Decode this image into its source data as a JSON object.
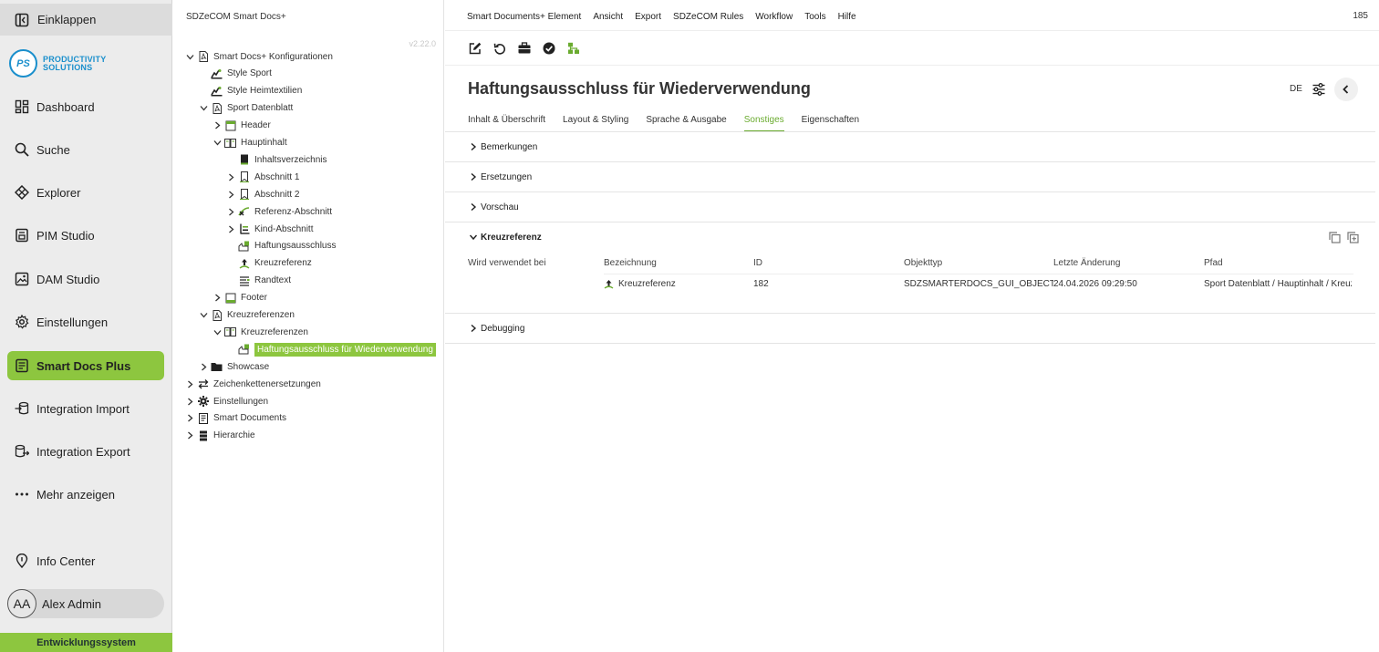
{
  "sidebar": {
    "collapse_label": "Einklappen",
    "logo_badge": "PS",
    "logo_line1": "PRODUCTIVITY",
    "logo_line2": "SOLUTIONS",
    "items": [
      {
        "label": "Dashboard",
        "icon": "dashboard-icon"
      },
      {
        "label": "Suche",
        "icon": "search-icon"
      },
      {
        "label": "Explorer",
        "icon": "explorer-icon"
      },
      {
        "label": "PIM Studio",
        "icon": "pim-icon"
      },
      {
        "label": "DAM Studio",
        "icon": "image-icon"
      },
      {
        "label": "Einstellungen",
        "icon": "gear-icon"
      },
      {
        "label": "Smart Docs Plus",
        "icon": "document-icon",
        "active": true
      },
      {
        "label": "Integration Import",
        "icon": "import-icon"
      },
      {
        "label": "Integration Export",
        "icon": "export-icon"
      },
      {
        "label": "Mehr anzeigen",
        "icon": "more-icon"
      }
    ],
    "info_center": "Info Center",
    "user_initials": "AA",
    "user_name": "Alex Admin",
    "environment": "Entwicklungssystem"
  },
  "tree": {
    "title": "SDZeCOM Smart Docs+",
    "version": "v2.22.0",
    "nodes": [
      {
        "label": "Smart Docs+ Konfigurationen",
        "icon": "pdf-icon",
        "caret": "down"
      },
      {
        "label": "Style Sport",
        "icon": "style-icon",
        "caret": "none"
      },
      {
        "label": "Style Heimtextilien",
        "icon": "style-icon",
        "caret": "none"
      },
      {
        "label": "Sport Datenblatt",
        "icon": "pdf-icon",
        "caret": "down"
      },
      {
        "label": "Header",
        "icon": "header-icon",
        "caret": "right"
      },
      {
        "label": "Hauptinhalt",
        "icon": "book-icon",
        "caret": "down"
      },
      {
        "label": "Inhaltsverzeichnis",
        "icon": "toc-icon",
        "caret": "none"
      },
      {
        "label": "Abschnitt 1",
        "icon": "bookmark-icon",
        "caret": "right"
      },
      {
        "label": "Abschnitt 2",
        "icon": "bookmark-icon",
        "caret": "right"
      },
      {
        "label": "Referenz-Abschnitt",
        "icon": "reference-icon",
        "caret": "right"
      },
      {
        "label": "Kind-Abschnitt",
        "icon": "child-section-icon",
        "caret": "right"
      },
      {
        "label": "Haftungsausschluss",
        "icon": "disclaimer-icon",
        "caret": "none"
      },
      {
        "label": "Kreuzreferenz",
        "icon": "crossref-icon",
        "caret": "none"
      },
      {
        "label": "Randtext",
        "icon": "margin-text-icon",
        "caret": "none"
      },
      {
        "label": "Footer",
        "icon": "footer-icon",
        "caret": "right"
      },
      {
        "label": "Kreuzreferenzen",
        "icon": "pdf-icon",
        "caret": "down"
      },
      {
        "label": "Kreuzreferenzen",
        "icon": "book-icon",
        "caret": "down"
      },
      {
        "label": "Haftungsausschluss für Wiederverwendung",
        "icon": "disclaimer-icon",
        "caret": "none",
        "selected": true
      },
      {
        "label": "Showcase",
        "icon": "folder-icon",
        "caret": "right"
      },
      {
        "label": "Zeichenkettenersetzungen",
        "icon": "swap-icon",
        "caret": "right"
      },
      {
        "label": "Einstellungen",
        "icon": "gear-icon",
        "caret": "right"
      },
      {
        "label": "Smart Documents",
        "icon": "docs-icon",
        "caret": "right"
      },
      {
        "label": "Hierarchie",
        "icon": "hierarchy-icon",
        "caret": "right"
      }
    ]
  },
  "menubar": {
    "items": [
      "Smart Documents+ Element",
      "Ansicht",
      "Export",
      "SDZeCOM Rules",
      "Workflow",
      "Tools",
      "Hilfe"
    ],
    "counter": "185"
  },
  "toolbar": [
    "edit-icon",
    "reload-icon",
    "briefcase-icon",
    "check-circle-icon",
    "tree-structure-icon"
  ],
  "page": {
    "title": "Haftungsausschluss für Wiederverwendung",
    "language": "DE",
    "tabs": [
      {
        "label": "Inhalt & Überschrift"
      },
      {
        "label": "Layout & Styling"
      },
      {
        "label": "Sprache & Ausgabe"
      },
      {
        "label": "Sonstiges",
        "active": true
      },
      {
        "label": "Eigenschaften"
      }
    ]
  },
  "sections": {
    "bemerkungen": "Bemerkungen",
    "ersetzungen": "Ersetzungen",
    "vorschau": "Vorschau",
    "kreuzreferenz": "Kreuzreferenz",
    "debugging": "Debugging"
  },
  "kreuzreferenz": {
    "used_in_label": "Wird verwendet bei",
    "columns": [
      "Bezeichnung",
      "ID",
      "Objekttyp",
      "Letzte Änderung",
      "Pfad"
    ],
    "rows": [
      {
        "name": "Kreuzreferenz",
        "id": "182",
        "type": "SDZSMARTERDOCS_GUI_OBJECTTYPE",
        "changed": "24.04.2026 09:29:50",
        "path": "Sport Datenblatt / Hauptinhalt / Kreuzreferenz"
      }
    ]
  },
  "colors": {
    "accent": "#8dc63f",
    "accent_text": "#6aab2f",
    "logo": "#1a8fcc"
  }
}
